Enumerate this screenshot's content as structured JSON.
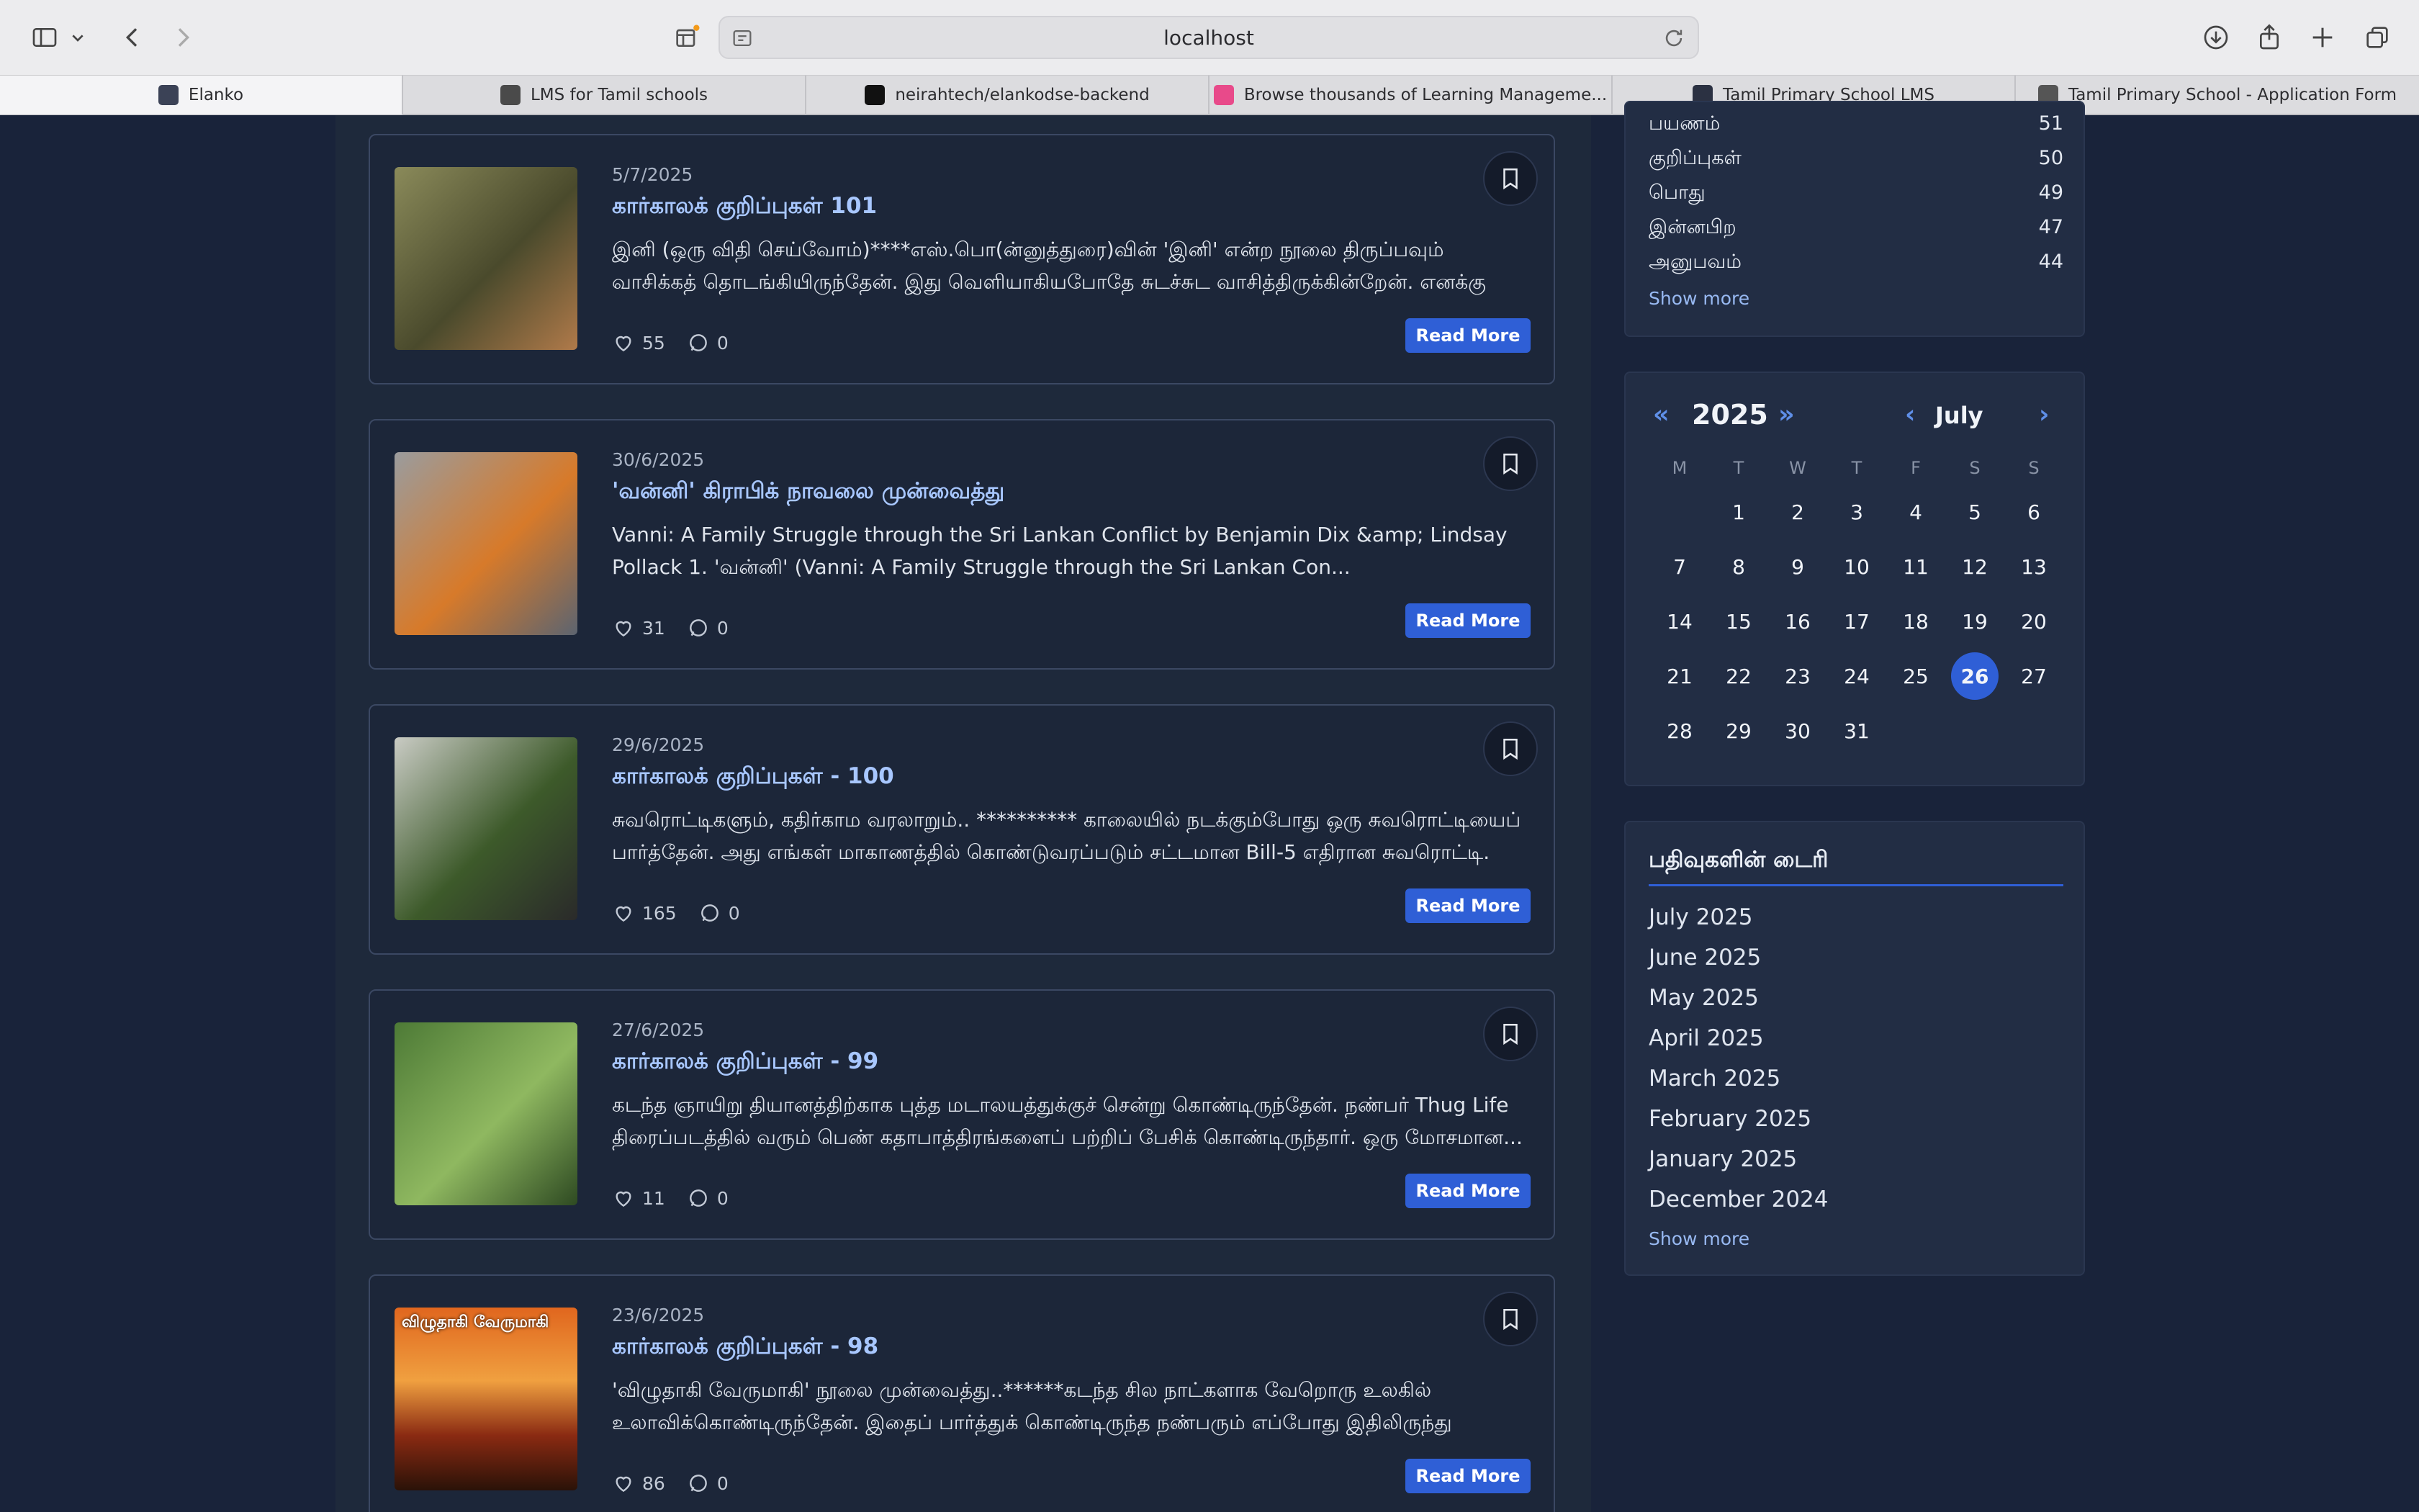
{
  "browser": {
    "address": "localhost",
    "tabs": [
      {
        "label": "Elanko",
        "favicon_color": "#3b4256"
      },
      {
        "label": "LMS for Tamil schools",
        "favicon_color": "#4a4a4a"
      },
      {
        "label": "neirahtech/elankodse-backend",
        "favicon_color": "#111111"
      },
      {
        "label": "Browse thousands of Learning Manageme...",
        "favicon_color": "#e84a8a"
      },
      {
        "label": "Tamil Primary School LMS",
        "favicon_color": "#2b3142"
      },
      {
        "label": "Tamil Primary School - Application Form",
        "favicon_color": "#555555"
      }
    ]
  },
  "posts": [
    {
      "date": "5/7/2025",
      "title": "கார்காலக் குறிப்புகள் 101",
      "excerpt": "இனி (ஒரு விதி செய்வோம்)****எஸ்.பொ(ன்னுத்துரை)வின் 'இனி' என்ற நூலை திருப்பவும் வாசிக்கத் தொடங்கியிருந்தேன். இது வெளியாகியபோதே சுடச்சுட வாசித்திருக்கின்றேன். எனக்கு மிகப் பிடித்த நூல்,...",
      "likes": "55",
      "comments": "0",
      "read_more": "Read More",
      "thumb_colors": [
        "#8a8a5a",
        "#4a4a2c",
        "#b07a4a"
      ]
    },
    {
      "date": "30/6/2025",
      "title": "'வன்னி' கிராபிக் நாவலை முன்வைத்து",
      "excerpt": "Vanni: A Family Struggle through the Sri Lankan Conflict by Benjamin Dix &amp; Lindsay Pollack 1. 'வன்னி' (Vanni: A Family Struggle through the Sri Lankan Con...",
      "likes": "31",
      "comments": "0",
      "read_more": "Read More",
      "thumb_colors": [
        "#9a9c9e",
        "#d77a2a",
        "#5c6470"
      ]
    },
    {
      "date": "29/6/2025",
      "title": "கார்காலக் குறிப்புகள் - 100",
      "excerpt": "சுவரொட்டிகளும், கதிர்காம வரலாறும்.. ********** காலையில் நடக்கும்போது ஒரு சுவரொட்டியைப் பார்த்தேன். அது எங்கள் மாகாணத்தில் கொண்டுவரப்படும் சட்டமான Bill-5 எதிரான சுவரொட்டி. இங்குள்ள...",
      "likes": "165",
      "comments": "0",
      "read_more": "Read More",
      "thumb_colors": [
        "#c9cbc4",
        "#3d5a2a",
        "#2a2a2a"
      ]
    },
    {
      "date": "27/6/2025",
      "title": "கார்காலக் குறிப்புகள் - 99",
      "excerpt": "கடந்த ஞாயிறு தியானத்திற்காக புத்த மடாலயத்துக்குச் சென்று கொண்டிருந்தேன். நண்பர் Thug Life திரைப்படத்தில் வரும் பெண் கதாபாத்திரங்களைப் பற்றிப் பேசிக் கொண்டிருந்தார். ஒரு மோசமான...",
      "likes": "11",
      "comments": "0",
      "read_more": "Read More",
      "thumb_colors": [
        "#4d7a36",
        "#8fb860",
        "#2e4a22"
      ]
    },
    {
      "date": "23/6/2025",
      "title": "கார்காலக் குறிப்புகள் - 98",
      "excerpt": "'விழுதாகி வேருமாகி' நூலை முன்வைத்து..******கடந்த சில நாட்களாக வேறொரு உலகில் உலாவிக்கொண்டிருந்தேன். இதைப் பார்த்துக் கொண்டிருந்த நண்பரும் எப்போது இதிலிருந்து வெளியே...",
      "likes": "86",
      "comments": "0",
      "read_more": "Read More",
      "thumb_colors": [
        "#e0661e",
        "#8a2a12",
        "#2a1208"
      ],
      "thumb_text": "விழுதாகி வேருமாகி"
    }
  ],
  "categories": {
    "items": [
      {
        "name": "பயணம்",
        "count": "51"
      },
      {
        "name": "குறிப்புகள்",
        "count": "50"
      },
      {
        "name": "பொது",
        "count": "49"
      },
      {
        "name": "இன்னபிற",
        "count": "47"
      },
      {
        "name": "அனுபவம்",
        "count": "44"
      }
    ],
    "show_more": "Show more"
  },
  "calendar": {
    "year": "2025",
    "month": "July",
    "prev_year": "«",
    "next_year": "»",
    "prev_month": "‹",
    "next_month": "›",
    "weekdays": [
      "M",
      "T",
      "W",
      "T",
      "F",
      "S",
      "S"
    ],
    "first_weekday_index": 1,
    "days_in_month": 31,
    "today": 26
  },
  "diary": {
    "title": "பதிவுகளின் டைரி",
    "months": [
      "July 2025",
      "June 2025",
      "May 2025",
      "April 2025",
      "March 2025",
      "February 2025",
      "January 2025",
      "December 2024"
    ],
    "show_more": "Show more"
  }
}
